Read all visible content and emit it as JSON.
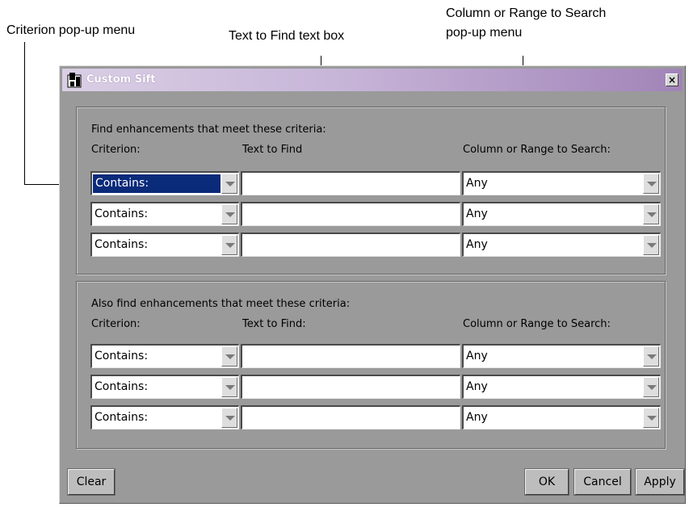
{
  "callouts": {
    "criterion_menu": "Criterion pop-up menu",
    "text_box": "Text to Find text box",
    "column_menu_line1": "Column or Range to Search",
    "column_menu_line2": "pop-up menu"
  },
  "window": {
    "title": "Custom Sift",
    "close_glyph": "×"
  },
  "group1": {
    "heading": "Find enhancements that meet these criteria:",
    "col_criterion": "Criterion:",
    "col_text": "Text to Find",
    "col_range": "Column or Range to Search:",
    "rows": [
      {
        "criterion": "Contains:",
        "text": "",
        "range": "Any",
        "selected": true
      },
      {
        "criterion": "Contains:",
        "text": "",
        "range": "Any",
        "selected": false
      },
      {
        "criterion": "Contains:",
        "text": "",
        "range": "Any",
        "selected": false
      }
    ]
  },
  "group2": {
    "heading": "Also find enhancements that meet these criteria:",
    "col_criterion": "Criterion:",
    "col_text": "Text to Find:",
    "col_range": "Column or Range to Search:",
    "rows": [
      {
        "criterion": "Contains:",
        "text": "",
        "range": "Any"
      },
      {
        "criterion": "Contains:",
        "text": "",
        "range": "Any"
      },
      {
        "criterion": "Contains:",
        "text": "",
        "range": "Any"
      }
    ]
  },
  "buttons": {
    "clear": "Clear",
    "ok": "OK",
    "cancel": "Cancel",
    "apply": "Apply"
  },
  "colors": {
    "window_bg": "#9a9a9a",
    "title_gradient_end": "#a184b8",
    "selection": "#0a2a7a"
  }
}
